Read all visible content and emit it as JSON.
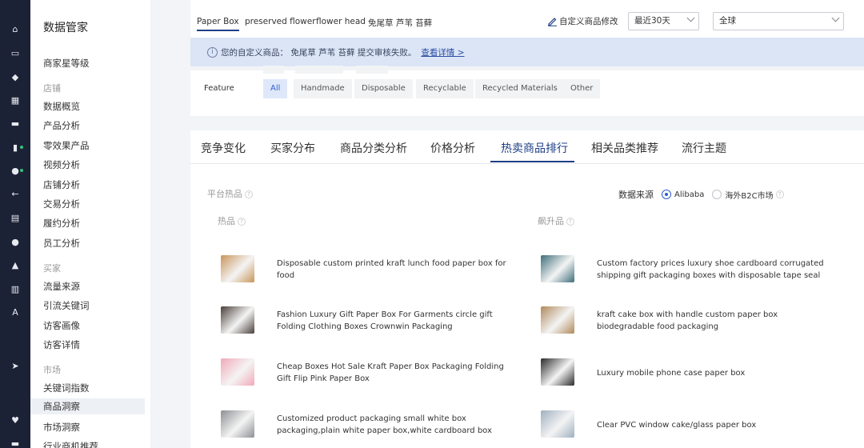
{
  "nav_rail": {
    "icons": [
      "home-icon",
      "shop-icon",
      "shield-icon",
      "grid-icon",
      "chat-icon",
      "chart-icon",
      "users-icon",
      "arrow-left-icon",
      "clipboard-icon",
      "globe-icon",
      "bell-icon",
      "bank-icon",
      "font-icon",
      "send-icon",
      "heart-icon",
      "card-icon"
    ]
  },
  "sidebar": {
    "title": "数据管家",
    "items": [
      {
        "type": "item",
        "label": "商家星等级"
      },
      {
        "type": "group",
        "label": "店铺"
      },
      {
        "type": "item",
        "label": "数据概览"
      },
      {
        "type": "item",
        "label": "产品分析"
      },
      {
        "type": "item",
        "label": "零效果产品"
      },
      {
        "type": "item",
        "label": "视频分析"
      },
      {
        "type": "item",
        "label": "店铺分析"
      },
      {
        "type": "item",
        "label": "交易分析"
      },
      {
        "type": "item",
        "label": "履约分析"
      },
      {
        "type": "item",
        "label": "员工分析"
      },
      {
        "type": "group",
        "label": "买家"
      },
      {
        "type": "item",
        "label": "流量来源"
      },
      {
        "type": "item",
        "label": "引流关键词"
      },
      {
        "type": "item",
        "label": "访客画像"
      },
      {
        "type": "item",
        "label": "访客详情"
      },
      {
        "type": "group",
        "label": "市场"
      },
      {
        "type": "item",
        "label": "关键词指数"
      },
      {
        "type": "item",
        "label": "商品洞察",
        "active": true
      },
      {
        "type": "item",
        "label": "市场洞察"
      },
      {
        "type": "item",
        "label": "行业商机推荐"
      }
    ]
  },
  "topbar": {
    "tags": [
      "Paper Box",
      "preserved flower",
      "flower head",
      "免尾草 芦苇 苔藓"
    ],
    "edit_label": "自定义商品修改",
    "period": "最近30天",
    "region": "全球"
  },
  "notice": {
    "text": "您的自定义商品：  免尾草 芦苇 苔藓 提交审核失败。",
    "link": "查看详情 >"
  },
  "feature": {
    "label": "Feature",
    "options": [
      "All",
      "Handmade",
      "Disposable",
      "Recyclable",
      "Recycled Materials",
      "Other"
    ],
    "selected": "All"
  },
  "tabs": [
    "竞争变化",
    "买家分布",
    "商品分类分析",
    "价格分析",
    "热卖商品排行",
    "相关品类推荐",
    "流行主题"
  ],
  "active_tab": "热卖商品排行",
  "hot": {
    "platform_label": "平台热品",
    "source_label": "数据来源",
    "sources": [
      "Alibaba",
      "海外B2C市场"
    ],
    "selected_source": "Alibaba",
    "left_header": "热品",
    "right_header": "飙升品",
    "left_products": [
      {
        "name": "Disposable custom printed kraft lunch food paper box for food",
        "thumb_color": "#c8955a"
      },
      {
        "name": "Fashion Luxury Gift Paper Box For Garments circle gift Folding Clothing Boxes Crownwin Packaging",
        "thumb_color": "#4a3f3a"
      },
      {
        "name": "Cheap Boxes Hot Sale Kraft Paper Box Packaging Folding Gift Flip Pink Paper Box",
        "thumb_color": "#f2a9b8"
      },
      {
        "name": "Customized product packaging small white box packaging,plain white paper box,white cardboard box",
        "thumb_color": "#8d8f94"
      }
    ],
    "right_products": [
      {
        "name": "Custom factory prices luxury shoe cardboard corrugated shipping gift packaging boxes with disposable tape seal",
        "thumb_color": "#3e6e7a"
      },
      {
        "name": "kraft cake box with handle custom paper box biodegradable food packaging",
        "thumb_color": "#b08a5c"
      },
      {
        "name": "Luxury mobile phone case paper box",
        "thumb_color": "#2b2b2b"
      },
      {
        "name": "Clear PVC window cake/glass paper box",
        "thumb_color": "#9fb0bf"
      }
    ]
  },
  "colors": {
    "rail_bg": "#1b2236",
    "accent": "#1f3f86",
    "selected_blue": "#2f5bd1",
    "notice_bg": "#dce5f6"
  }
}
